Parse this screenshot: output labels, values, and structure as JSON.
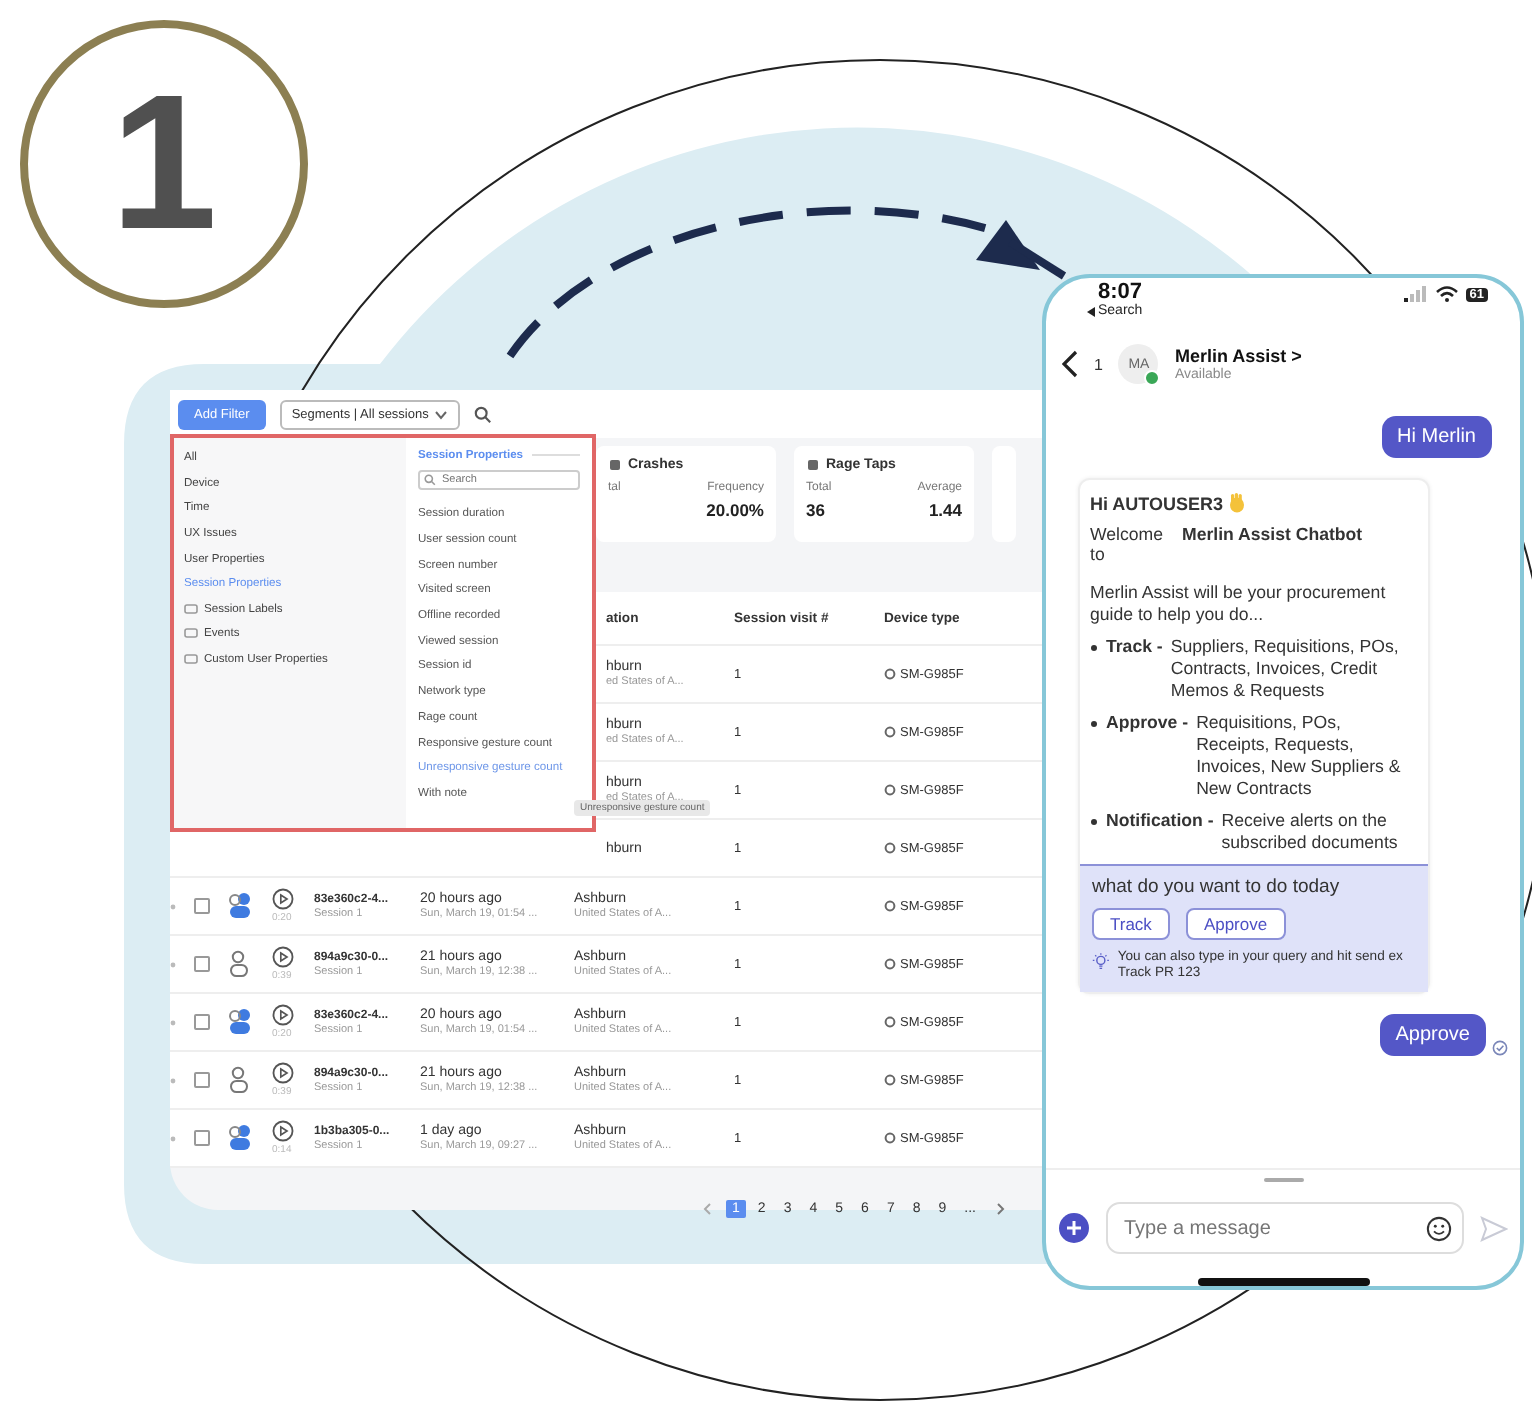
{
  "step": "1",
  "dashboard": {
    "toolbar": {
      "add_filter": "Add Filter",
      "segments": "Segments | All sessions"
    },
    "stats": [
      {
        "title": "Crashes",
        "metrics": [
          {
            "label": "tal"
          },
          {
            "label": "Frequency",
            "value": "20.00%"
          }
        ]
      },
      {
        "title": "Rage Taps",
        "metrics": [
          {
            "label": "Total",
            "value": "36"
          },
          {
            "label": "Average",
            "value": "1.44"
          }
        ]
      }
    ],
    "filter_menu": {
      "categories": [
        {
          "label": "All",
          "kind": "plain",
          "selected": false
        },
        {
          "label": "Device",
          "kind": "plain",
          "selected": false
        },
        {
          "label": "Time",
          "kind": "plain",
          "selected": false
        },
        {
          "label": "UX Issues",
          "kind": "plain",
          "selected": false
        },
        {
          "label": "User Properties",
          "kind": "plain",
          "selected": false
        },
        {
          "label": "Session Properties",
          "kind": "plain",
          "selected": true
        },
        {
          "label": "Session Labels",
          "kind": "group",
          "selected": false
        },
        {
          "label": "Events",
          "kind": "group",
          "selected": false
        },
        {
          "label": "Custom User Properties",
          "kind": "group",
          "selected": false
        }
      ],
      "heading": "Session Properties",
      "search": {
        "placeholder": "Search"
      },
      "properties": [
        {
          "label": "Session duration",
          "selected": false
        },
        {
          "label": "User session count",
          "selected": false
        },
        {
          "label": "Screen number",
          "selected": false
        },
        {
          "label": "Visited screen",
          "selected": false
        },
        {
          "label": "Offline recorded",
          "selected": false
        },
        {
          "label": "Viewed session",
          "selected": false
        },
        {
          "label": "Session id",
          "selected": false
        },
        {
          "label": "Network type",
          "selected": false
        },
        {
          "label": "Rage count",
          "selected": false
        },
        {
          "label": "Responsive gesture count",
          "selected": false
        },
        {
          "label": "Unresponsive gesture count",
          "selected": true
        },
        {
          "label": "With note",
          "selected": false
        }
      ],
      "tooltip": "Unresponsive gesture count"
    },
    "table": {
      "columns": [
        "ation",
        "Session visit #",
        "Device type"
      ],
      "rows": [
        {
          "city": "hburn",
          "country": "ed States of A...",
          "visits": "1",
          "device": "SM-G985F"
        },
        {
          "city": "hburn",
          "country": "ed States of A...",
          "visits": "1",
          "device": "SM-G985F"
        },
        {
          "city": "hburn",
          "country": "ed States of A...",
          "visits": "1",
          "device": "SM-G985F"
        },
        {
          "city": "hburn",
          "visits": "1",
          "device": "SM-G985F"
        },
        {
          "checked": false,
          "linked": true,
          "duration": "0:20",
          "id": "83e360c2-4...",
          "session": "Session 1",
          "ago": "20 hours ago",
          "date": "Sun, March 19, 01:54 ...",
          "city": "Ashburn",
          "country": "United States of A...",
          "visits": "1",
          "device": "SM-G985F"
        },
        {
          "checked": false,
          "linked": false,
          "duration": "0:39",
          "id": "894a9c30-0...",
          "session": "Session 1",
          "ago": "21 hours ago",
          "date": "Sun, March 19, 12:38 ...",
          "city": "Ashburn",
          "country": "United States of A...",
          "visits": "1",
          "device": "SM-G985F"
        },
        {
          "checked": false,
          "linked": true,
          "duration": "0:20",
          "id": "83e360c2-4...",
          "session": "Session 1",
          "ago": "20 hours ago",
          "date": "Sun, March 19, 01:54 ...",
          "city": "Ashburn",
          "country": "United States of A...",
          "visits": "1",
          "device": "SM-G985F"
        },
        {
          "checked": false,
          "linked": false,
          "duration": "0:39",
          "id": "894a9c30-0...",
          "session": "Session 1",
          "ago": "21 hours ago",
          "date": "Sun, March 19, 12:38 ...",
          "city": "Ashburn",
          "country": "United States of A...",
          "visits": "1",
          "device": "SM-G985F"
        },
        {
          "checked": false,
          "linked": true,
          "duration": "0:14",
          "id": "1b3ba305-0...",
          "session": "Session 1",
          "ago": "1 day ago",
          "date": "Sun, March 19, 09:27 ...",
          "city": "Ashburn",
          "country": "United States of A...",
          "visits": "1",
          "device": "SM-G985F"
        }
      ]
    },
    "pagination": {
      "pages": [
        {
          "label": "1",
          "selected": true
        },
        {
          "label": "2",
          "selected": false
        },
        {
          "label": "3",
          "selected": false
        },
        {
          "label": "4",
          "selected": false
        },
        {
          "label": "5",
          "selected": false
        },
        {
          "label": "6",
          "selected": false
        },
        {
          "label": "7",
          "selected": false
        },
        {
          "label": "8",
          "selected": false
        },
        {
          "label": "9",
          "selected": false
        },
        {
          "label": "...",
          "selected": false
        }
      ]
    }
  },
  "phone": {
    "status": {
      "time": "8:07",
      "back_app": "Search",
      "battery": "61"
    },
    "header": {
      "count": "1",
      "avatar": "MA",
      "online": true,
      "name": "Merlin Assist >",
      "status": "Available"
    },
    "messages": [
      {
        "kind": "user",
        "text": "Hi Merlin"
      },
      {
        "kind": "bot",
        "greeting": "Hi AUTOUSER3",
        "welcome": "Welcome to",
        "product": "Merlin Assist Chatbot",
        "intro": "Merlin Assist will be your procurement guide to help you do...",
        "features": [
          {
            "label": "Track -",
            "text": "Suppliers, Requisitions, POs, Contracts, Invoices, Credit Memos & Requests"
          },
          {
            "label": "Approve -",
            "text": "Requisitions, POs, Receipts, Requests, Invoices, New Suppliers & New Contracts"
          },
          {
            "label": "Notification -",
            "text": "Receive alerts on the subscribed documents"
          }
        ],
        "prompt": "what do you want to do today",
        "options": [
          "Track",
          "Approve"
        ],
        "tip": "You can also type in your query and hit send ex Track PR 123"
      },
      {
        "kind": "user",
        "text": "Approve",
        "read": true
      }
    ],
    "composer": {
      "placeholder": "Type a message"
    }
  }
}
